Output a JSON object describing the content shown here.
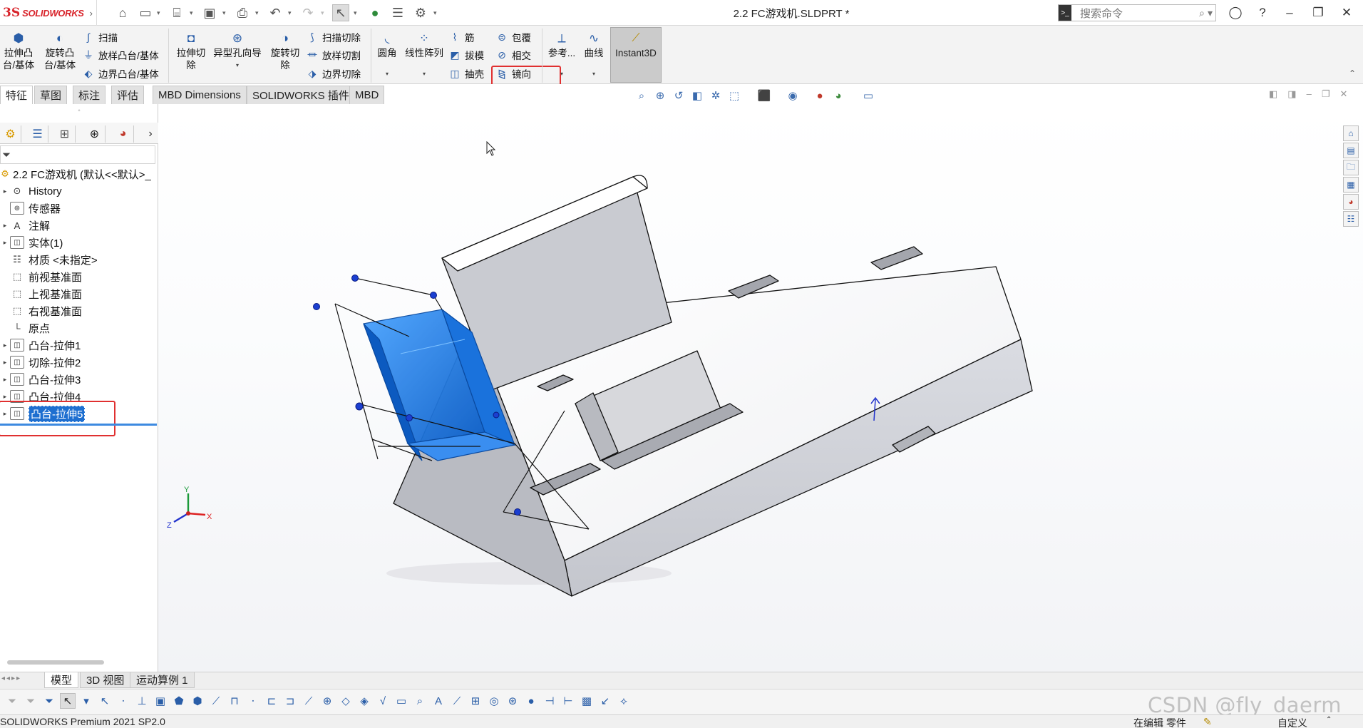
{
  "app": {
    "logo_ds": "3S",
    "logo_text": "SOLIDWORKS",
    "doc_title": "2.2 FC游戏机.SLDPRT *"
  },
  "search": {
    "placeholder": "搜索命令"
  },
  "ribbon": {
    "extrude_boss": "拉伸凸\n台/基体",
    "revolve_boss": "旋转凸\n台/基体",
    "sweep": "扫描",
    "loft": "放样凸台/基体",
    "boundary": "边界凸台/基体",
    "extrude_cut": "拉伸切\n除",
    "hole_wizard": "异型孔向导",
    "revolve_cut": "旋转切\n除",
    "sweep_cut": "扫描切除",
    "loft_cut": "放样切割",
    "boundary_cut": "边界切除",
    "fillet": "圆角",
    "linear_pattern": "线性阵列",
    "rib": "筋",
    "draft": "拔模",
    "shell": "抽壳",
    "wrap": "包覆",
    "intersect": "相交",
    "mirror": "镜向",
    "reference": "参考...",
    "curves": "曲线",
    "instant3d": "Instant3D"
  },
  "tabs": [
    "特征",
    "草图",
    "标注",
    "评估",
    "MBD Dimensions",
    "SOLIDWORKS 插件",
    "MBD"
  ],
  "tree": {
    "root": "2.2 FC游戏机  (默认<<默认>_",
    "items": [
      {
        "label": "History"
      },
      {
        "label": "传感器"
      },
      {
        "label": "注解"
      },
      {
        "label": "实体(1)"
      },
      {
        "label": "材质 <未指定>"
      },
      {
        "label": "前视基准面"
      },
      {
        "label": "上视基准面"
      },
      {
        "label": "右视基准面"
      },
      {
        "label": "原点"
      },
      {
        "label": "凸台-拉伸1"
      },
      {
        "label": "切除-拉伸2"
      },
      {
        "label": "凸台-拉伸3"
      },
      {
        "label": "凸台-拉伸4"
      },
      {
        "label": "凸台-拉伸5"
      }
    ]
  },
  "bottom_tabs": [
    "模型",
    "3D 视图",
    "运动算例 1"
  ],
  "status": {
    "left": "SOLIDWORKS Premium 2021 SP2.0",
    "mode": "在编辑 零件",
    "custom": "自定义"
  },
  "triad": {
    "x": "X",
    "y": "Y",
    "z": "Z"
  },
  "watermark": "CSDN @fly_daerm",
  "colors": {
    "selection": "#1e6fd0",
    "highlight_box": "#e03030",
    "preview_body": "#1f7fe6"
  }
}
